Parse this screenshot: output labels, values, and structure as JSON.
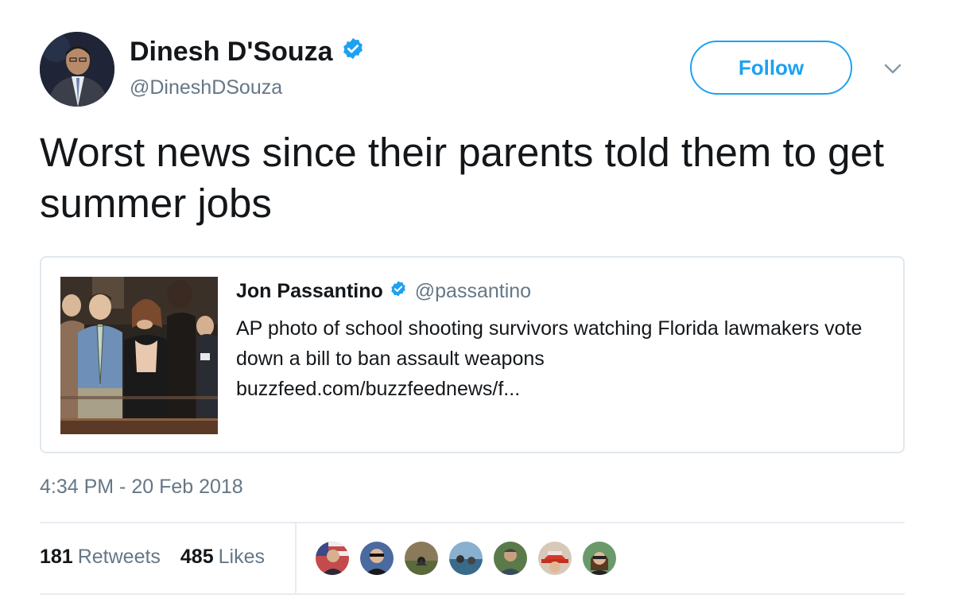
{
  "author": {
    "name": "Dinesh D'Souza",
    "handle": "@DineshDSouza",
    "verified": true
  },
  "follow_button": {
    "label": "Follow"
  },
  "tweet": {
    "text": "Worst news since their parents told them to get summer jobs",
    "timestamp": "4:34 PM - 20 Feb 2018"
  },
  "quoted_tweet": {
    "name": "Jon Passantino",
    "handle": "@passantino",
    "verified": true,
    "text": "AP photo of school shooting survivors watching Florida lawmakers vote down a bill to ban assault weapons",
    "link": "buzzfeed.com/buzzfeednews/f..."
  },
  "stats": {
    "retweets": {
      "count": "181",
      "label": "Retweets"
    },
    "likes": {
      "count": "485",
      "label": "Likes"
    }
  },
  "colors": {
    "accent": "#1da1f2",
    "text": "#14171a",
    "secondary": "#657786",
    "border": "#e1e8ed"
  },
  "icons": [
    "verified-badge-icon",
    "chevron-down-icon"
  ]
}
